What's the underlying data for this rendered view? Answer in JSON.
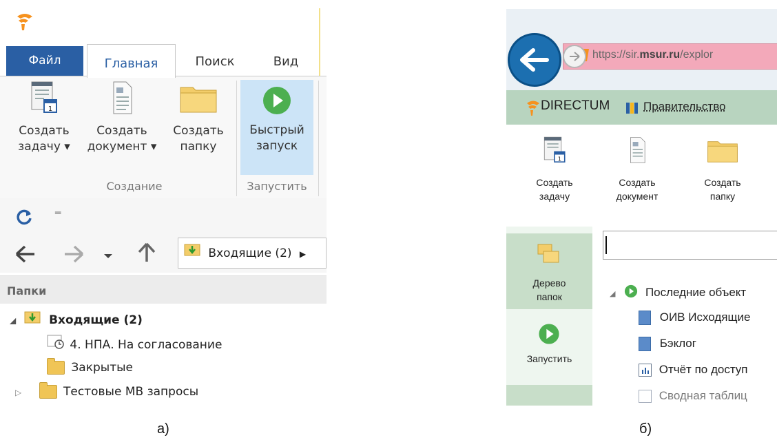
{
  "panel_a": {
    "tabs": [
      "Файл",
      "Главная",
      "Поиск",
      "Вид"
    ],
    "ribbon": {
      "create_task": [
        "Создать",
        "задачу ▾"
      ],
      "create_doc": [
        "Создать",
        "документ ▾"
      ],
      "create_folder": [
        "Создать",
        "папку"
      ],
      "quick_run": [
        "Быстрый",
        "запуск"
      ],
      "group_create": "Создание",
      "group_run": "Запустить"
    },
    "address": "Входящие (2)",
    "folders_header": "Папки",
    "tree": {
      "root": "Входящие (2)",
      "item1": "4. НПА. На согласование",
      "item2": "Закрытые",
      "item3": "Тестовые МВ запросы"
    },
    "caption": "а)"
  },
  "panel_b": {
    "url_plain": "https://sir.",
    "url_bold": "msur.ru",
    "url_rest": "/explor",
    "brand": "DIRECTUM",
    "gov_link": "Правительство",
    "ribbon": {
      "create_task": [
        "Создать",
        "задачу"
      ],
      "create_doc": [
        "Создать",
        "документ"
      ],
      "create_folder": [
        "Создать",
        "папку"
      ]
    },
    "side": {
      "tree": [
        "Дерево",
        "папок"
      ],
      "run": "Запустить"
    },
    "rows": [
      "Последние объект",
      "ОИВ Исходящие",
      "Бэклог",
      "Отчёт по доступ",
      "Сводная таблиц"
    ],
    "caption": "б)"
  },
  "colors": {
    "file_tab": "#2a5fa4",
    "run_highlight": "#cce4f7",
    "green_bar": "#b8d4bf",
    "url_bar": "#f3a9ba"
  }
}
